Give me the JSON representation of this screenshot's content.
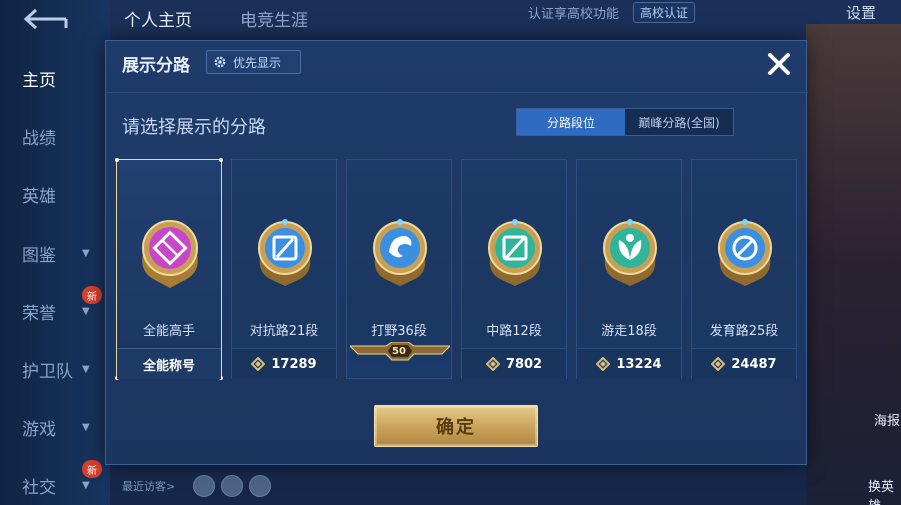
{
  "top_tabs": {
    "profile": "个人主页",
    "career": "电竞生涯"
  },
  "top_bar": {
    "hint": "认证享高校功能",
    "campus_button": "高校认证",
    "settings": "设置"
  },
  "left_nav": [
    {
      "label": "主页",
      "active": true
    },
    {
      "label": "战绩"
    },
    {
      "label": "英雄"
    },
    {
      "label": "图鉴",
      "chevron": true
    },
    {
      "label": "荣誉",
      "chevron": true,
      "badge": "新"
    },
    {
      "label": "护卫队",
      "chevron": true
    },
    {
      "label": "游戏",
      "chevron": true
    },
    {
      "label": "社交",
      "chevron": true,
      "badge": "新"
    }
  ],
  "recent_visitors": "最近访客>",
  "side_labels": {
    "top": "海报",
    "bottom": "换英雄"
  },
  "modal": {
    "title": "展示分路",
    "priority_button": "优先显示",
    "subtitle": "请选择展示的分路",
    "segments": [
      {
        "label": "分路段位",
        "active": true
      },
      {
        "label": "巅峰分路(全国)",
        "active": false
      }
    ],
    "cards": [
      {
        "name": "全能高手",
        "footer": "全能称号",
        "score": "",
        "selected": true,
        "color": "#c846c8",
        "icon": "all-round-icon"
      },
      {
        "name": "对抗路21段",
        "footer": "",
        "score": "17289",
        "color": "#3a8fe0",
        "icon": "sword-icon"
      },
      {
        "name": "打野36段",
        "footer": "",
        "score": "",
        "level": "50",
        "color": "#3a8fe0",
        "icon": "dragon-icon"
      },
      {
        "name": "中路12段",
        "footer": "",
        "score": "7802",
        "color": "#2fb59a",
        "icon": "staff-icon"
      },
      {
        "name": "游走18段",
        "footer": "",
        "score": "13224",
        "color": "#2fb59a",
        "icon": "leaf-icon"
      },
      {
        "name": "发育路25段",
        "footer": "",
        "score": "24487",
        "color": "#3a8fe0",
        "icon": "target-icon"
      }
    ],
    "confirm_button": "确定"
  },
  "colors": {
    "accent": "#2f6bc0",
    "gold": "#c9a25a",
    "panel": "#1f3b6a"
  }
}
